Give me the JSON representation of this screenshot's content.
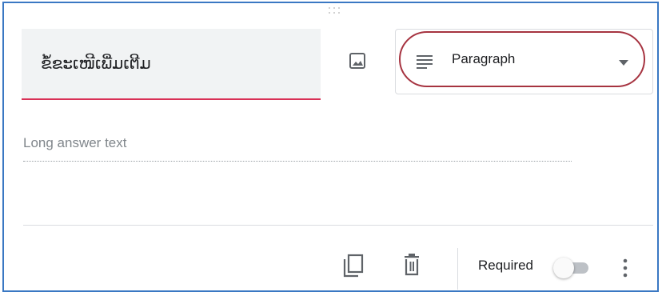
{
  "question": {
    "title": "ຂໍ້ຂະເໜີເພີ່ມເຕີມ"
  },
  "question_type": {
    "selected": "Paragraph",
    "icon": "short-text-icon"
  },
  "answer": {
    "placeholder": "Long answer text"
  },
  "footer": {
    "required_label": "Required",
    "required_on": false
  },
  "colors": {
    "accent_underline": "#d93056",
    "highlight_circle": "#a63340",
    "border": "#3a78c3"
  }
}
